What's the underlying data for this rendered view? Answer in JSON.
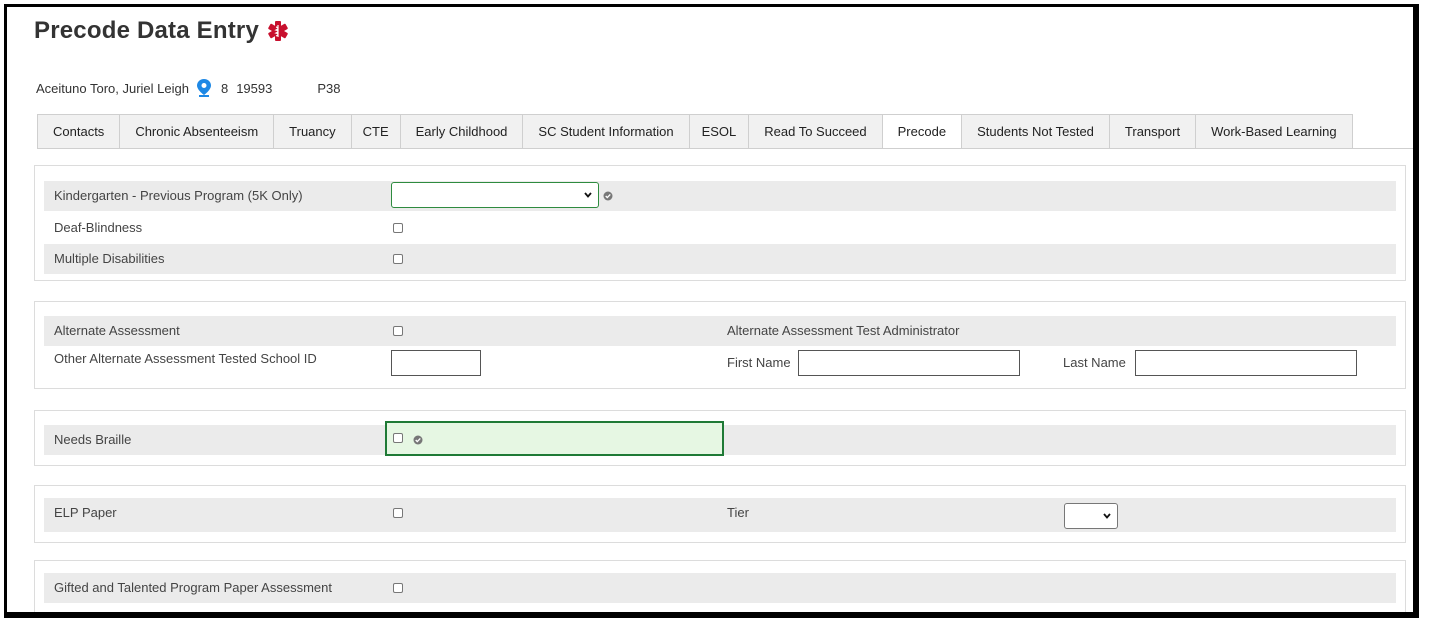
{
  "page": {
    "title": "Precode Data Entry"
  },
  "student": {
    "name": "Aceituno Toro, Juriel Leigh",
    "grade": "8",
    "id": "19593",
    "code": "P38"
  },
  "tabs": [
    "Contacts",
    "Chronic Absenteeism",
    "Truancy",
    "CTE",
    "Early Childhood",
    "SC Student Information",
    "ESOL",
    "Read To Succeed",
    "Precode",
    "Students Not Tested",
    "Transport",
    "Work-Based Learning"
  ],
  "active_tab": "Precode",
  "section1": {
    "kindergarten_label": "Kindergarten - Previous Program (5K Only)",
    "kindergarten_value": "",
    "deaf_blindness_label": "Deaf-Blindness",
    "multiple_disabilities_label": "Multiple Disabilities"
  },
  "section2": {
    "alternate_assessment_label": "Alternate Assessment",
    "other_school_id_label": "Other Alternate Assessment Tested School ID",
    "other_school_id_value": "",
    "test_admin_header": "Alternate Assessment Test Administrator",
    "first_name_label": "First Name",
    "first_name_value": "",
    "last_name_label": "Last Name",
    "last_name_value": ""
  },
  "section3": {
    "needs_braille_label": "Needs Braille"
  },
  "section4": {
    "elp_paper_label": "ELP Paper",
    "tier_label": "Tier",
    "tier_value": ""
  },
  "section5": {
    "gifted_label": "Gifted and Talented Program Paper Assessment"
  },
  "colors": {
    "highlight_border": "#1f7a36",
    "highlight_fill": "#e6f7e3",
    "alert_red": "#c8102e",
    "pin_blue": "#1e88e5",
    "row_shade": "#ebebeb"
  },
  "icons": {
    "alert": "medical-alert-icon",
    "location": "location-pin-icon",
    "valid": "check-circle-icon",
    "dropdown": "chevron-down-icon"
  }
}
